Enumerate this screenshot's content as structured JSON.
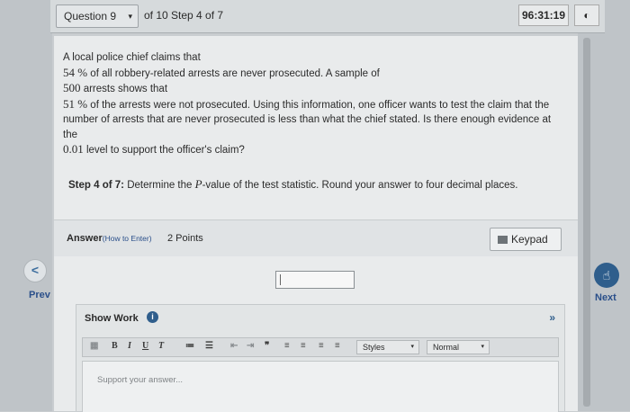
{
  "header": {
    "question_label": "Question 9",
    "progress": "of 10 Step 4 of 7",
    "timer": "96:31:19",
    "timer_icon": "eye-slash-icon"
  },
  "question": {
    "lines": [
      "A local police chief claims that",
      "54 %",
      "of all robbery-related arrests are never prosecuted. A sample of",
      "500",
      "arrests shows that",
      "51 %",
      "of the arrests were not prosecuted. Using this information, one officer wants to test the claim that the number of arrests that are never prosecuted is less than what the chief stated. Is there enough evidence at the",
      "0.01",
      "level to support the officer's claim?"
    ]
  },
  "step": {
    "label": "Step 4 of 7:",
    "text_before": "Determine the",
    "var": "P",
    "text_after": "-value of the test statistic. Round your answer to four decimal places."
  },
  "answer": {
    "label": "Answer",
    "how_to": "(How to Enter)",
    "points": "2 Points",
    "keypad_label": "Keypad",
    "input_value": ""
  },
  "nav": {
    "prev_label": "Prev",
    "next_label": "Next",
    "prev_icon": "chevron-left-icon",
    "next_icon": "hand-pointer-icon"
  },
  "show_work": {
    "title": "Show Work",
    "toolbar": {
      "styles_label": "Styles",
      "format_label": "Normal"
    },
    "placeholder": "Support your answer..."
  }
}
